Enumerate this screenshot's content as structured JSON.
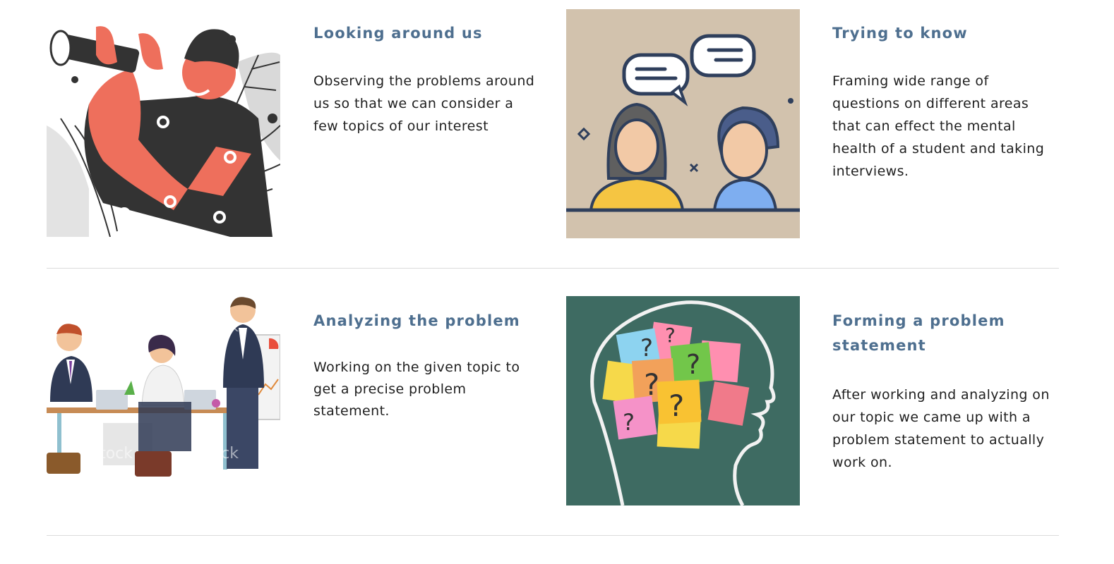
{
  "steps": [
    {
      "title": "Looking around us",
      "body": "Observing the problems around us so that we can consider a few topics of our interest",
      "icon": "binoculars-person-illustration"
    },
    {
      "title": "Trying to know",
      "body": "Framing wide range of questions on different areas that can effect the mental health of a student and taking interviews.",
      "icon": "interview-chat-illustration"
    },
    {
      "title": "Analyzing the problem",
      "body": "Working on the given topic to get a precise problem statement.",
      "icon": "office-team-illustration"
    },
    {
      "title": "Forming a problem statement",
      "body": "After working and analyzing on our topic we came up with a problem statement to actually work on.",
      "icon": "head-question-notes-illustration"
    }
  ],
  "watermark": "iStock",
  "colors": {
    "heading": "#4e6f8f",
    "body_text": "#1f1f1f",
    "divider": "#dcdcdc",
    "interview_bg": "#d2c2ad",
    "chalkboard_bg": "#3e6b62",
    "accent_coral": "#ee6f5c"
  }
}
